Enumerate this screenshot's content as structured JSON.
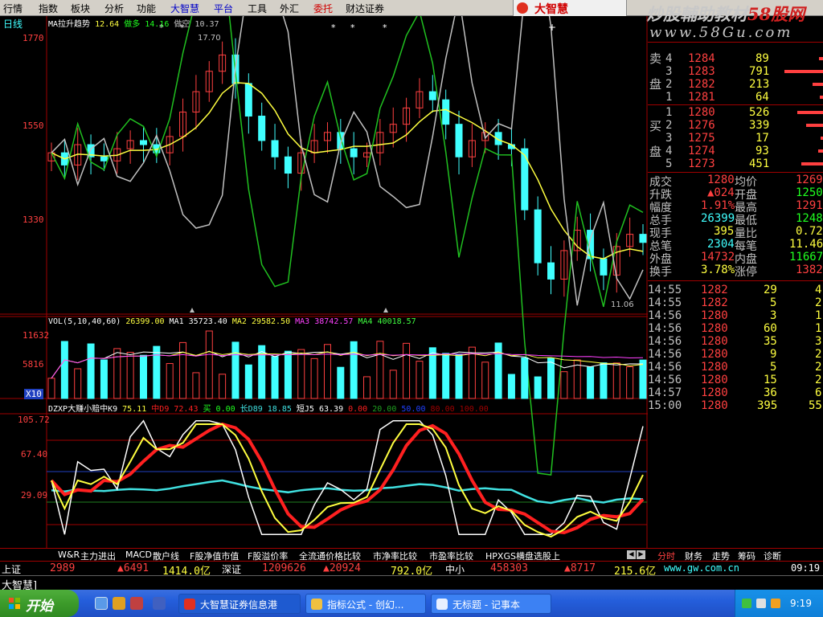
{
  "menu": [
    "行情",
    "指数",
    "板块",
    "分析",
    "功能",
    "大智慧",
    "平台",
    "工具",
    "外汇",
    "委托",
    "财达证券"
  ],
  "brand": "大智慧",
  "watermark": {
    "line1_a": "炒股輔助教材",
    "line1_b": "58股网",
    "line2": "www.58Gu.com"
  },
  "price_panel": {
    "period": "日线",
    "legend": {
      "name": "MA拉升趋势",
      "v1": "12.64",
      "lab2": "做多",
      "v2": "14.16",
      "lab3": "做空",
      "v3": "10.37"
    },
    "y_labels": [
      "1770",
      "1550",
      "1330"
    ],
    "high_label": "17.70",
    "low_label": "11.06"
  },
  "volume_panel": {
    "legend": {
      "name": "VOL(5,10,40,60)",
      "vol": "26399.00",
      "ma1_l": "MA1",
      "ma1": "35723.40",
      "ma2_l": "MA2",
      "ma2": "29582.50",
      "ma3_l": "MA3",
      "ma3": "38742.57",
      "ma4_l": "MA4",
      "ma4": "40018.57"
    },
    "y_labels": [
      "11632",
      "5816"
    ],
    "unit": "X10"
  },
  "kdj_panel": {
    "legend": {
      "name": "DZXP大赚小赔中K9",
      "v1": "75.11",
      "lab2": "中D9",
      "v2": "72.43",
      "lab3": "买",
      "v3": "0.00",
      "lab4": "长D89",
      "v4": "18.85",
      "lab5": "短J5",
      "v5": "63.39",
      "v6": "0.00",
      "v7": "20.00",
      "v8": "50.00",
      "v9": "80.00",
      "v10": "100.00"
    },
    "y_labels": [
      "105.72",
      "67.40",
      "29.09"
    ]
  },
  "chart_data": [
    {
      "type": "candlestick",
      "title": "MA拉升趋势",
      "ylim": [
        11.0,
        17.9
      ],
      "y_ticks": [
        17.7,
        15.5,
        13.3
      ],
      "candles_close_approx": [
        14.9,
        14.6,
        15.1,
        14.8,
        14.7,
        15.0,
        15.2,
        15.1,
        14.9,
        15.3,
        15.9,
        16.4,
        16.9,
        17.3,
        16.6,
        15.8,
        15.2,
        14.8,
        14.4,
        14.9,
        15.2,
        15.4,
        15.0,
        14.8,
        14.9,
        15.4,
        15.6,
        16.0,
        16.4,
        16.2,
        15.6,
        14.8,
        15.2,
        15.4,
        15.1,
        15.0,
        13.5,
        12.2,
        11.8,
        12.5,
        13.0,
        12.3,
        11.9,
        12.6,
        12.9,
        12.7
      ],
      "series": [
        {
          "name": "MA拉升趋势",
          "color": "#ffff40"
        },
        {
          "name": "做多",
          "color": "#20c020"
        },
        {
          "name": "做空",
          "color": "#c0c0c0"
        }
      ],
      "annotations": [
        "17.70",
        "11.06"
      ]
    },
    {
      "type": "bar",
      "title": "VOL(5,10,40,60)",
      "y_ticks": [
        11632,
        5816
      ],
      "unit": "X10",
      "series": [
        {
          "name": "MA1",
          "value": 35723.4,
          "color": "#ffffff"
        },
        {
          "name": "MA2",
          "value": 29582.5,
          "color": "#ffff40"
        },
        {
          "name": "MA3",
          "value": 38742.57,
          "color": "#ff40ff"
        },
        {
          "name": "MA4",
          "value": 40018.57,
          "color": "#40ff40"
        }
      ],
      "last_volume": 26399.0
    },
    {
      "type": "line",
      "title": "DZXP大赚小赔",
      "y_ticks": [
        105.72,
        67.4,
        29.09
      ],
      "series": [
        {
          "name": "中K9",
          "value": 75.11,
          "color": "#ffff40"
        },
        {
          "name": "中D9",
          "value": 72.43,
          "color": "#ff2020"
        },
        {
          "name": "买",
          "value": 0.0,
          "color": "#20ff20"
        },
        {
          "name": "长D89",
          "value": 18.85,
          "color": "#40e0e0"
        },
        {
          "name": "短J5",
          "value": 63.39,
          "color": "#ffffff"
        }
      ],
      "reference_lines": [
        0.0,
        20.0,
        50.0,
        80.0,
        100.0
      ]
    }
  ],
  "order_book": {
    "sell_label": [
      "卖",
      "盘"
    ],
    "buy_label": [
      "买",
      "盘"
    ],
    "sell": [
      {
        "n": "4",
        "price": "1284",
        "vol": "89"
      },
      {
        "n": "3",
        "price": "1283",
        "vol": "791"
      },
      {
        "n": "2",
        "price": "1282",
        "vol": "213"
      },
      {
        "n": "1",
        "price": "1281",
        "vol": "64"
      }
    ],
    "buy": [
      {
        "n": "1",
        "price": "1280",
        "vol": "526"
      },
      {
        "n": "2",
        "price": "1276",
        "vol": "339"
      },
      {
        "n": "3",
        "price": "1275",
        "vol": "17"
      },
      {
        "n": "4",
        "price": "1274",
        "vol": "93"
      },
      {
        "n": "5",
        "price": "1273",
        "vol": "451"
      }
    ]
  },
  "stats": [
    {
      "l1": "成交",
      "v1": "1280",
      "l2": "均价",
      "v2": "1269"
    },
    {
      "l1": "升跌",
      "v1": "▲024",
      "l2": "开盘",
      "v2": "1250"
    },
    {
      "l1": "幅度",
      "v1": "1.91%",
      "l2": "最高",
      "v2": "1291"
    },
    {
      "l1": "总手",
      "v1": "26399",
      "l2": "最低",
      "v2": "1248"
    },
    {
      "l1": "现手",
      "v1": "395",
      "l2": "量比",
      "v2": "0.72"
    },
    {
      "l1": "总笔",
      "v1": "2304",
      "l2": "每笔",
      "v2": "11.46"
    },
    {
      "l1": "外盘",
      "v1": "14732",
      "l2": "内盘",
      "v2": "11667"
    },
    {
      "l1": "换手",
      "v1": "3.78%",
      "l2": "涨停",
      "v2": "1382"
    }
  ],
  "ticks": [
    {
      "t": "14:55",
      "p": "1282",
      "v": "29",
      "n": "4"
    },
    {
      "t": "14:55",
      "p": "1282",
      "v": "5",
      "n": "2"
    },
    {
      "t": "14:56",
      "p": "1280",
      "v": "3",
      "n": "1"
    },
    {
      "t": "14:56",
      "p": "1280",
      "v": "60",
      "n": "1"
    },
    {
      "t": "14:56",
      "p": "1280",
      "v": "35",
      "n": "3"
    },
    {
      "t": "14:56",
      "p": "1280",
      "v": "9",
      "n": "2"
    },
    {
      "t": "14:56",
      "p": "1280",
      "v": "5",
      "n": "2"
    },
    {
      "t": "14:56",
      "p": "1280",
      "v": "15",
      "n": "2"
    },
    {
      "t": "14:57",
      "p": "1280",
      "v": "36",
      "n": "6"
    },
    {
      "t": "15:00",
      "p": "1280",
      "v": "395",
      "n": "55"
    }
  ],
  "formula_tabs": [
    "W&R",
    "主力进出",
    "MACD",
    "散户线",
    "F股净值市值",
    "F股溢价率",
    "全流通价格比较",
    "市净率比较",
    "市盈率比较",
    "HPXGS横盘选股上"
  ],
  "right_tabs": [
    "分时",
    "财务",
    "走势",
    "筹码",
    "诊断"
  ],
  "index_bar": {
    "sh_label": "上证",
    "sh_val": "2989",
    "sh_chg": "▲6491",
    "sh_amt": "1414.0亿",
    "sz_label": "深证",
    "sz_val": "1209626",
    "sz_chg": "▲20924",
    "sz_amt": "792.0亿",
    "zx_label": "中小",
    "zx_val": "458303",
    "zx_chg": "▲8717",
    "zx_amt": "215.6亿",
    "url": "www.gw.com.cn",
    "time": "09:19"
  },
  "status2_label": "大智慧]",
  "taskbar": {
    "start": "开始",
    "items": [
      "大智慧证券信息港",
      "指标公式 - 创幻...",
      "无标题 - 记事本"
    ],
    "clock": "9:19"
  }
}
